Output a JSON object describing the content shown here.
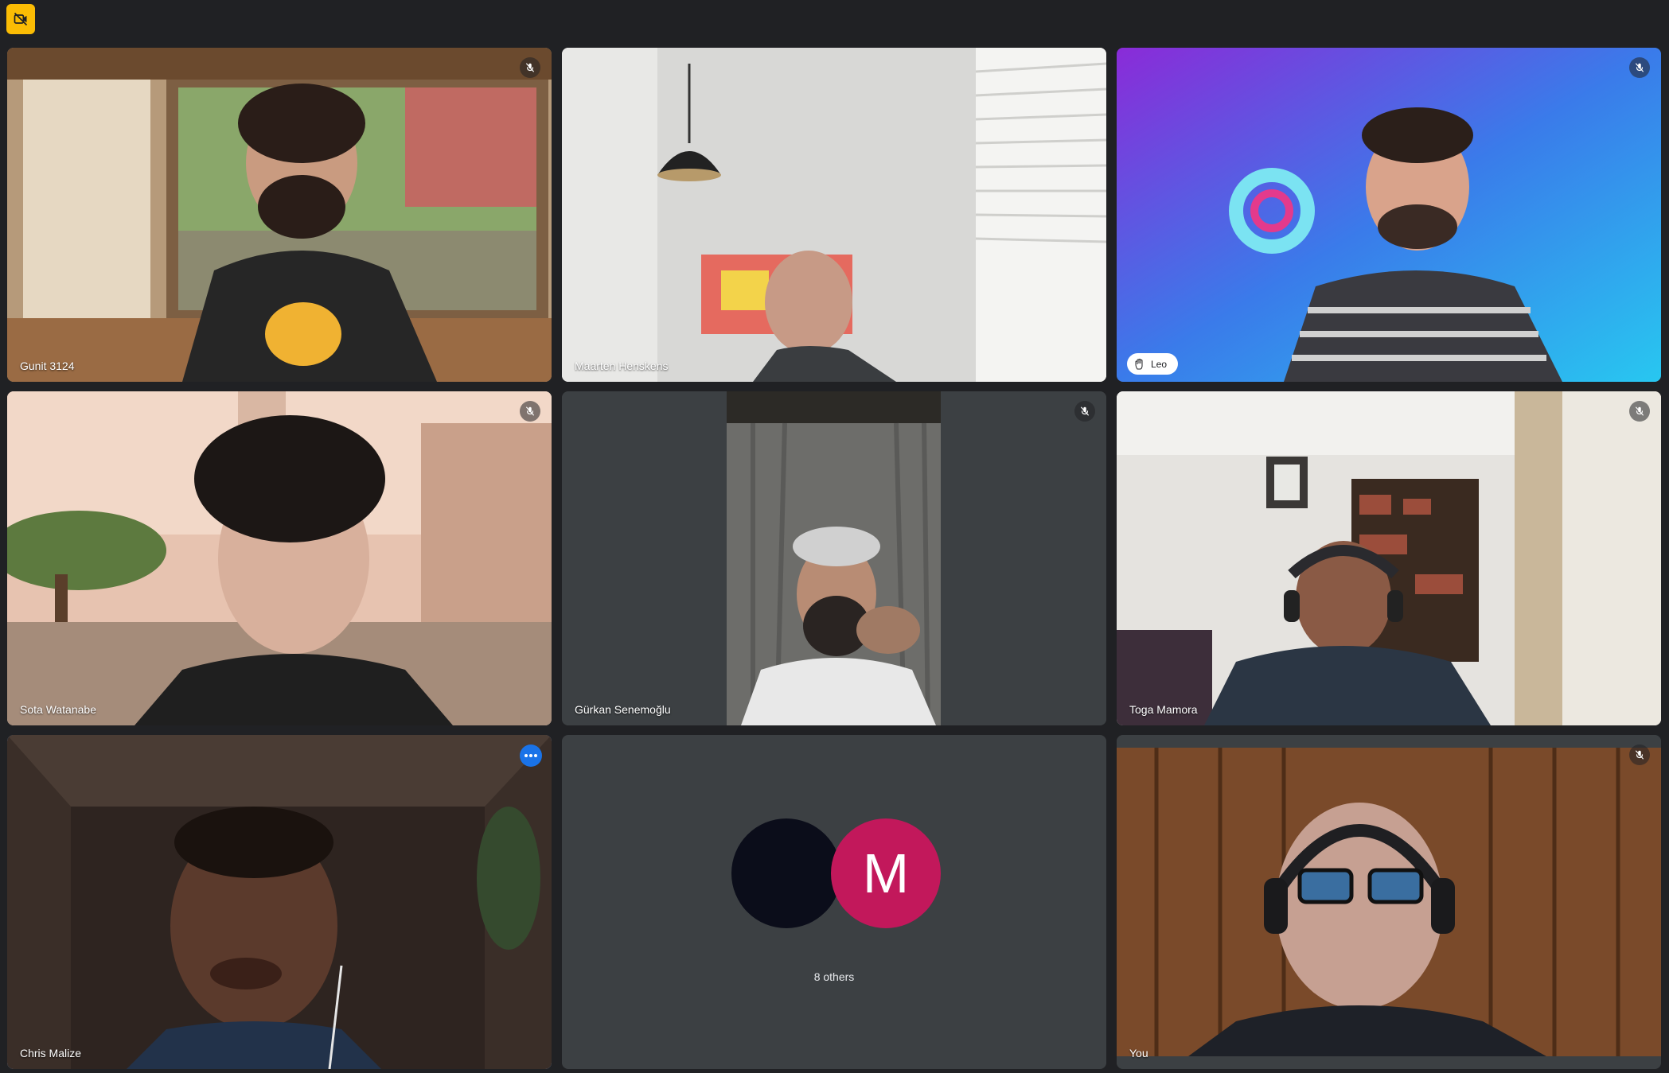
{
  "app": {
    "badge_icon": "no-camera-icon",
    "badge_color": "#fbbc04",
    "active_tile_border": "#8ab4f8"
  },
  "tiles": [
    {
      "name": "Gunit 3124",
      "muted": true
    },
    {
      "name": "Maarten Henskens",
      "muted": false
    },
    {
      "name": "Leo",
      "muted": true,
      "hand_raised": true
    },
    {
      "name": "Sota Watanabe",
      "muted": true
    },
    {
      "name": "Gürkan Senemoğlu",
      "muted": true
    },
    {
      "name": "Toga Mamora",
      "muted": true
    },
    {
      "name": "Chris Malize",
      "active": true,
      "menu_icon": "more-options-icon"
    },
    {
      "others_label": "8 others",
      "avatar_letter": "M",
      "avatar_color": "#c2185b"
    },
    {
      "name": "You",
      "muted": true
    }
  ]
}
